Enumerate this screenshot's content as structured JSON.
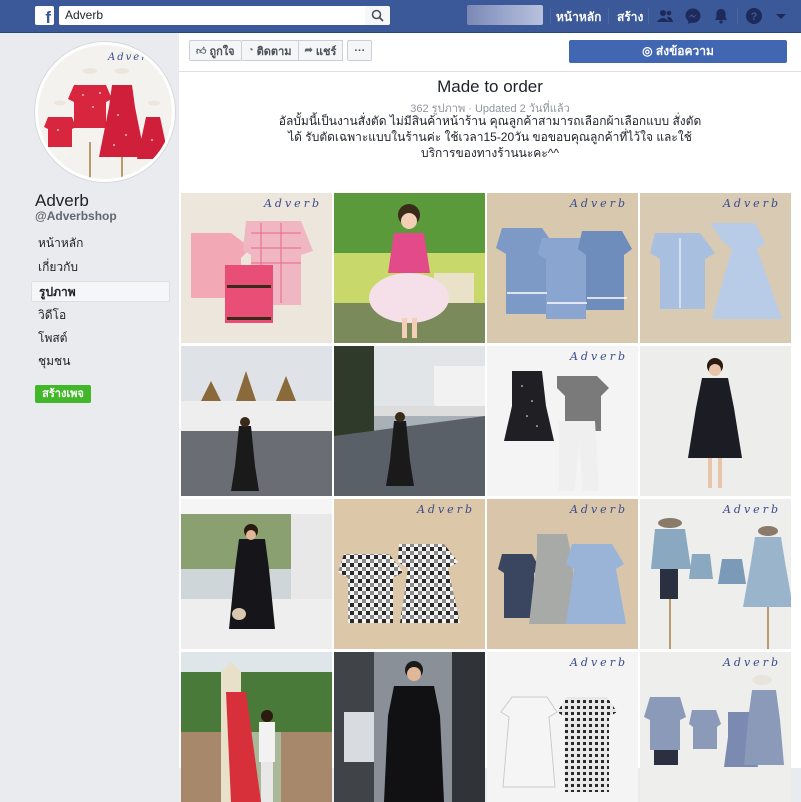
{
  "topbar": {
    "search_value": "Adverb",
    "nav_home": "หน้าหลัก",
    "nav_create": "สร้าง",
    "icons": [
      "search-icon",
      "friends-icon",
      "messenger-icon",
      "notifications-icon",
      "help-icon",
      "caret-down-icon"
    ]
  },
  "sidebar": {
    "page_name": "Adverb",
    "page_handle": "@Adverbshop",
    "items": [
      {
        "label": "หน้าหลัก"
      },
      {
        "label": "เกี่ยวกับ"
      },
      {
        "label": "รูปภาพ"
      },
      {
        "label": "วิดีโอ"
      },
      {
        "label": "โพสต์"
      },
      {
        "label": "ชุมชน"
      }
    ],
    "create_page": "สร้างเพจ"
  },
  "toolbar": {
    "like": "ถูกใจ",
    "follow": "ติดตาม",
    "share": "แชร์",
    "more": "···",
    "send_message": "ส่งข้อความ"
  },
  "album": {
    "title": "Made to order",
    "meta": "362 รูปภาพ · Updated 2 วันที่แล้ว",
    "description": "อัลบั้มนี้เป็นงานสั่งตัด ไม่มีสินค้าหน้าร้าน คุณลูกค้าสามารถเลือกผ้าเลือกแบบ สั่งตัดได้ รับตัดเฉพาะแบบในร้านค่ะ ใช้เวลา15-20วัน ขอขอบคุณลูกค้าที่ไว้ใจ และใช้บริการของทางร้านนะคะ^^"
  },
  "photos": {
    "watermark": "Adverb",
    "count_visible": 16
  },
  "colors": {
    "topbar": "#3b5998",
    "primary_button": "#4267b2",
    "create_page": "#42b72a"
  }
}
